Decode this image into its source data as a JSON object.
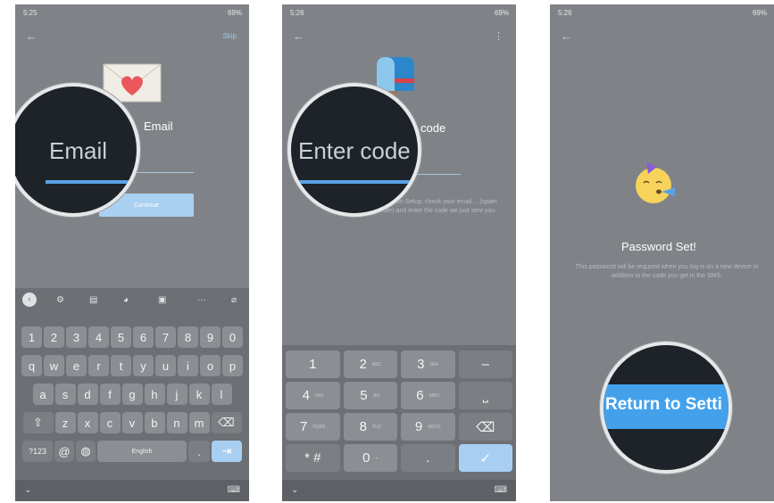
{
  "panel1": {
    "status_time": "5:25",
    "status_right": "69%",
    "skip": "Skip",
    "title": "Email",
    "continue_label": "Continue",
    "magnifier_text": "Email",
    "toolbar_icons": [
      "back-icon",
      "gear-icon",
      "clipboard-icon",
      "palette-icon",
      "paste-icon",
      "more-icon",
      "mic-off-icon"
    ],
    "row_numbers": [
      "1",
      "2",
      "3",
      "4",
      "5",
      "6",
      "7",
      "8",
      "9",
      "0"
    ],
    "row_q": [
      "q",
      "w",
      "e",
      "r",
      "t",
      "y",
      "u",
      "i",
      "o",
      "p"
    ],
    "row_a": [
      "a",
      "s",
      "d",
      "f",
      "g",
      "h",
      "j",
      "k",
      "l"
    ],
    "row_z": [
      "z",
      "x",
      "c",
      "v",
      "b",
      "n",
      "m"
    ],
    "sym_key": "?123",
    "at_key": "@",
    "space_label": "English",
    "dot_key": "."
  },
  "panel2": {
    "status_time": "5:26",
    "status_right": "69%",
    "title": "code",
    "magnifier_text": "Enter code",
    "description": "…ification Setup, check your email …(spam folder) and enter the code we just sent you.",
    "keys": [
      {
        "main": "1",
        "sub": ""
      },
      {
        "main": "2",
        "sub": "ABC"
      },
      {
        "main": "3",
        "sub": "DEF"
      },
      {
        "main": "–",
        "sub": ""
      },
      {
        "main": "4",
        "sub": "GHI"
      },
      {
        "main": "5",
        "sub": "JKL"
      },
      {
        "main": "6",
        "sub": "MNO"
      },
      {
        "main": "⎵",
        "sub": ""
      },
      {
        "main": "7",
        "sub": "PQRS"
      },
      {
        "main": "8",
        "sub": "TUV"
      },
      {
        "main": "9",
        "sub": "WXYZ"
      },
      {
        "main": "⌫",
        "sub": ""
      },
      {
        "main": "* #",
        "sub": ""
      },
      {
        "main": "0",
        "sub": "+"
      },
      {
        "main": ".",
        "sub": ""
      },
      {
        "main": "✓",
        "sub": ""
      }
    ]
  },
  "panel3": {
    "status_time": "5:26",
    "status_right": "69%",
    "title": "Password Set!",
    "description": "This password will be required when you log in on a new device in addition to the code you get in the SMS.",
    "button_label": "Return to Setti"
  }
}
